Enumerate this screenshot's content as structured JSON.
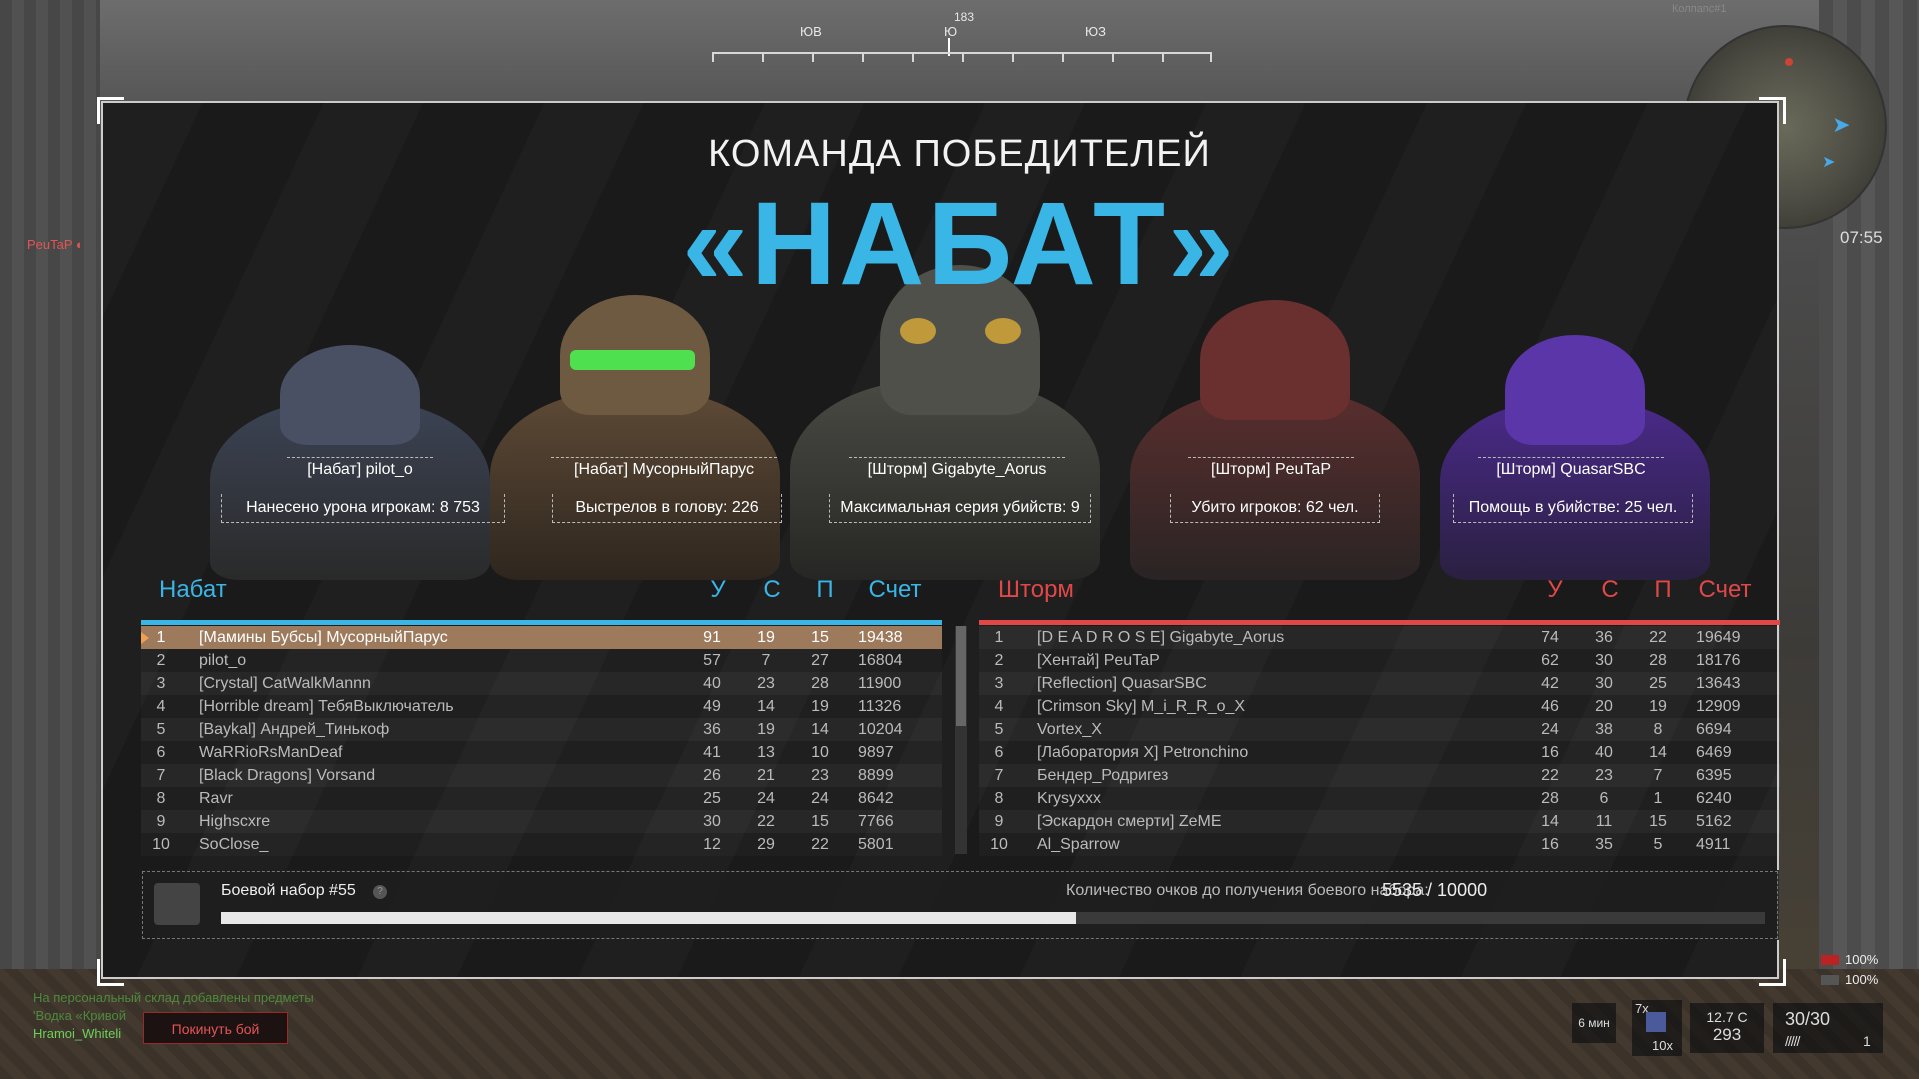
{
  "compass": {
    "heading": "183",
    "labels": [
      {
        "text": "ЮВ"
      },
      {
        "text": "Ю"
      },
      {
        "text": "ЮЗ"
      }
    ]
  },
  "minimap": {
    "label": "Колпапс#1",
    "timer": "07:55"
  },
  "enemy_tag": "PeuTaP",
  "winner": {
    "subtitle": "КОМАНДА ПОБЕДИТЕЛЕЙ",
    "team": "«НАБАТ»"
  },
  "awards": [
    {
      "player": "[Набат] pilot_o",
      "stat": "Нанесено урона игрокам: 8 753"
    },
    {
      "player": "[Набат] МусорныйПарус",
      "stat": "Выстрелов в голову: 226"
    },
    {
      "player": "[Шторм] Gigabyte_Aorus",
      "stat": "Максимальная серия убийств: 9"
    },
    {
      "player": "[Шторм] PeuTaP",
      "stat": "Убито игроков: 62 чел."
    },
    {
      "player": "[Шторм] QuasarSBC",
      "stat": "Помощь в убийстве: 25 чел."
    }
  ],
  "columns": {
    "kills": "У",
    "deaths": "С",
    "assists": "П",
    "score": "Счет"
  },
  "team_left": {
    "name": "Набат",
    "color": "#39b5e6",
    "rows": [
      {
        "rank": "1",
        "name": "[Мамины Бубсы] МусорныйПарус",
        "k": "91",
        "d": "19",
        "a": "15",
        "score": "19438"
      },
      {
        "rank": "2",
        "name": "pilot_o",
        "k": "57",
        "d": "7",
        "a": "27",
        "score": "16804"
      },
      {
        "rank": "3",
        "name": "[Crystal] CatWalkMannn",
        "k": "40",
        "d": "23",
        "a": "28",
        "score": "11900"
      },
      {
        "rank": "4",
        "name": "[Horrible dream] ТебяВыключатель",
        "k": "49",
        "d": "14",
        "a": "19",
        "score": "11326"
      },
      {
        "rank": "5",
        "name": "[Baykal] Андрей_Тинькоф",
        "k": "36",
        "d": "19",
        "a": "14",
        "score": "10204"
      },
      {
        "rank": "6",
        "name": "WaRRioRsManDeaf",
        "k": "41",
        "d": "13",
        "a": "10",
        "score": "9897"
      },
      {
        "rank": "7",
        "name": "[Black Dragons] Vorsand",
        "k": "26",
        "d": "21",
        "a": "23",
        "score": "8899"
      },
      {
        "rank": "8",
        "name": "Ravr",
        "k": "25",
        "d": "24",
        "a": "24",
        "score": "8642"
      },
      {
        "rank": "9",
        "name": "Highscxre",
        "k": "30",
        "d": "22",
        "a": "15",
        "score": "7766"
      },
      {
        "rank": "10",
        "name": "SoClose_",
        "k": "12",
        "d": "29",
        "a": "22",
        "score": "5801"
      }
    ]
  },
  "team_right": {
    "name": "Шторм",
    "color": "#e04848",
    "rows": [
      {
        "rank": "1",
        "name": "[D E A D R O S E] Gigabyte_Aorus",
        "k": "74",
        "d": "36",
        "a": "22",
        "score": "19649"
      },
      {
        "rank": "2",
        "name": "[Хентай] PeuTaP",
        "k": "62",
        "d": "30",
        "a": "28",
        "score": "18176"
      },
      {
        "rank": "3",
        "name": "[Reflection] QuasarSBC",
        "k": "42",
        "d": "30",
        "a": "25",
        "score": "13643"
      },
      {
        "rank": "4",
        "name": "[Crimson Sky] M_i_R_R_o_X",
        "k": "46",
        "d": "20",
        "a": "19",
        "score": "12909"
      },
      {
        "rank": "5",
        "name": "Vortex_X",
        "k": "24",
        "d": "38",
        "a": "8",
        "score": "6694"
      },
      {
        "rank": "6",
        "name": "[Лаборатория X] Petronchino",
        "k": "16",
        "d": "40",
        "a": "14",
        "score": "6469"
      },
      {
        "rank": "7",
        "name": "Бендер_Родригез",
        "k": "22",
        "d": "23",
        "a": "7",
        "score": "6395"
      },
      {
        "rank": "8",
        "name": "Krysyxxx",
        "k": "28",
        "d": "6",
        "a": "1",
        "score": "6240"
      },
      {
        "rank": "9",
        "name": "[Эскардон смерти] ZeME",
        "k": "14",
        "d": "11",
        "a": "15",
        "score": "5162"
      },
      {
        "rank": "10",
        "name": "Al_Sparrow",
        "k": "16",
        "d": "35",
        "a": "5",
        "score": "4911"
      }
    ]
  },
  "kit": {
    "title": "Боевой набор #55",
    "help": "?",
    "progress_label": "Количество очков до получения боевого набора:",
    "progress_value": "5535 / 10000",
    "progress_fraction": 0.5535
  },
  "chat": [
    "На персональный склад добавлены предметы",
    "'Водка «Кривой",
    "Hramoi_Whiteli"
  ],
  "leave_button": "Покинуть бой",
  "hud": {
    "time_left": "6 мин",
    "grenade_count": "7x",
    "multiplier": "10x",
    "temp": "12.7 C",
    "money": "293",
    "ammo": "30/30",
    "magazines": "1",
    "health": "100%",
    "armor": "100%"
  }
}
